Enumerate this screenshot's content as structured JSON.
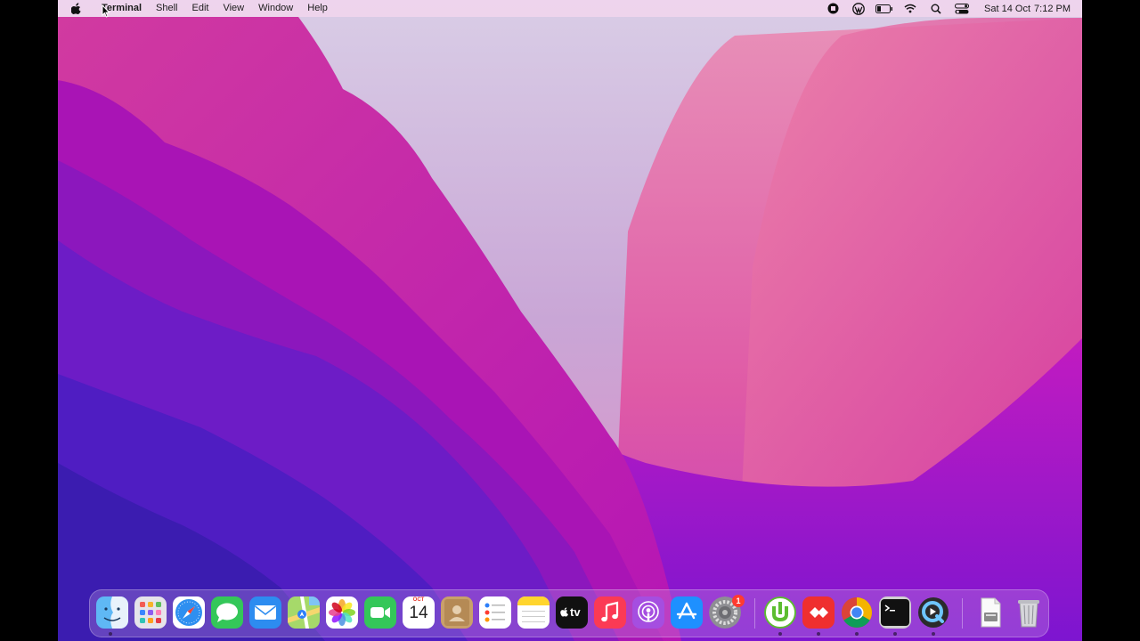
{
  "menubar": {
    "app_name": "Terminal",
    "menus": [
      "Shell",
      "Edit",
      "View",
      "Window",
      "Help"
    ],
    "clock_date": "Sat 14 Oct",
    "clock_time": "7:12 PM",
    "status_icons": [
      "screen-record-icon",
      "wordpress-icon",
      "battery-icon",
      "wifi-icon",
      "spotlight-search-icon",
      "control-center-icon"
    ]
  },
  "dock": {
    "apps": [
      "Finder",
      "Launchpad",
      "Safari",
      "Messages",
      "Mail",
      "Maps",
      "Photos",
      "FaceTime",
      "Calendar",
      "Contacts",
      "Reminders",
      "Notes",
      "TV",
      "Music",
      "Podcasts",
      "App Store",
      "System Preferences",
      "uTorrent",
      "AnyDesk",
      "Google Chrome",
      "Terminal",
      "QuickTime Player",
      "Document",
      "Trash"
    ],
    "calendar_month": "OCT",
    "calendar_day": "14",
    "tv_label": "tv",
    "system_preferences_badge": "1"
  },
  "colors": {
    "menubar": "#f4d6ee",
    "wallpaper_magenta": "#c41fa8",
    "wallpaper_violet": "#5a1dc7",
    "wallpaper_pink": "#e06aa8"
  }
}
